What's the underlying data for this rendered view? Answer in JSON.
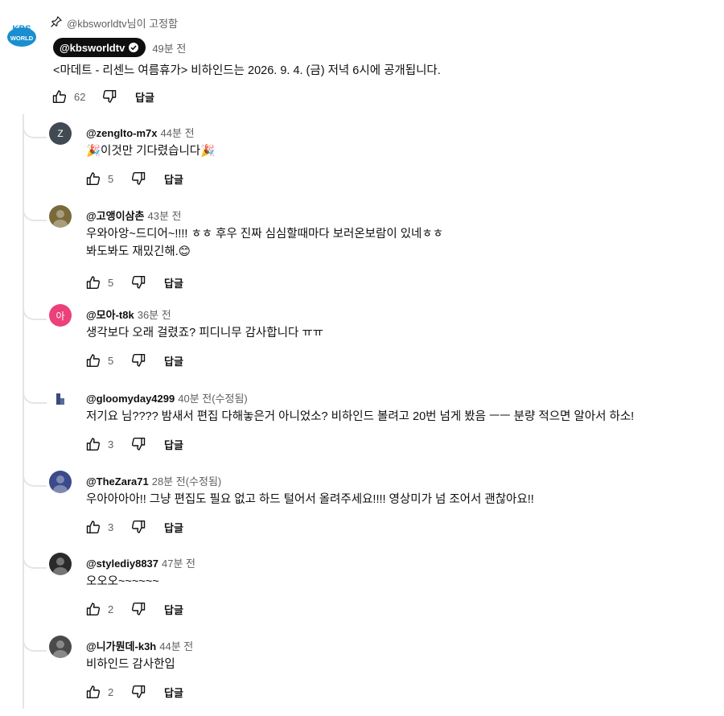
{
  "pinned": {
    "label": "@kbsworldtv님이 고정함",
    "channel": "@kbsworldtv",
    "time": "49분 전",
    "text": "<마데트 - 리센느 여름휴가> 비하인드는 2026. 9. 4. (금) 저녁 6시에 공개됩니다.",
    "likes": "62",
    "reply_label": "답글",
    "avatar_text_top": "KBS",
    "avatar_text_bottom": "WORLD"
  },
  "replies": [
    {
      "author": "@zenglto-m7x",
      "time": "44분 전",
      "lines": [
        "🎉이것만 기다렸습니다🎉"
      ],
      "likes": "5",
      "reply_label": "답글",
      "avatar_initial": "Z",
      "avatar_color": "#414a52"
    },
    {
      "author": "@고앵이삼촌",
      "time": "43분 전",
      "lines": [
        "우와아앙~드디어~!!!! ㅎㅎ 후우 진짜 심심할때마다 보러온보람이 있네ㅎㅎ",
        "봐도봐도 재밌긴해.😊"
      ],
      "likes": "5",
      "reply_label": "답글",
      "avatar_initial": "",
      "avatar_color": "#7a6a3a"
    },
    {
      "author": "@모아-t8k",
      "time": "36분 전",
      "lines": [
        "생각보다 오래 걸렸죠? 피디니무 감사합니다 ㅠㅠ"
      ],
      "likes": "5",
      "reply_label": "답글",
      "avatar_initial": "아",
      "avatar_color": "#ec407a"
    },
    {
      "author": "@gloomyday4299",
      "time": "40분 전(수정됨)",
      "lines": [
        "저기요 님???? 밤새서 편집 다해놓은거 아니었소? 비하인드 볼려고 20번 넘게 봤음 ㅡㅡ  분량 적으면 알아서 하소!"
      ],
      "likes": "3",
      "reply_label": "답글",
      "avatar_initial": "",
      "avatar_color": "#ffffff"
    },
    {
      "author": "@TheZara71",
      "time": "28분 전(수정됨)",
      "lines": [
        "우아아아아!! 그냥 편집도 필요 없고 하드 털어서 올려주세요!!!! 영상미가 넘 조어서 괜찮아요!!"
      ],
      "likes": "3",
      "reply_label": "답글",
      "avatar_initial": "",
      "avatar_color": "#3a4a8a"
    },
    {
      "author": "@stylediy8837",
      "time": "47분 전",
      "lines": [
        "오오오~~~~~~"
      ],
      "likes": "2",
      "reply_label": "답글",
      "avatar_initial": "",
      "avatar_color": "#2a2a2a"
    },
    {
      "author": "@니가뭔데-k3h",
      "time": "44분 전",
      "lines": [
        "비하인드 감사한입"
      ],
      "likes": "2",
      "reply_label": "답글",
      "avatar_initial": "",
      "avatar_color": "#4a4a4a"
    }
  ]
}
